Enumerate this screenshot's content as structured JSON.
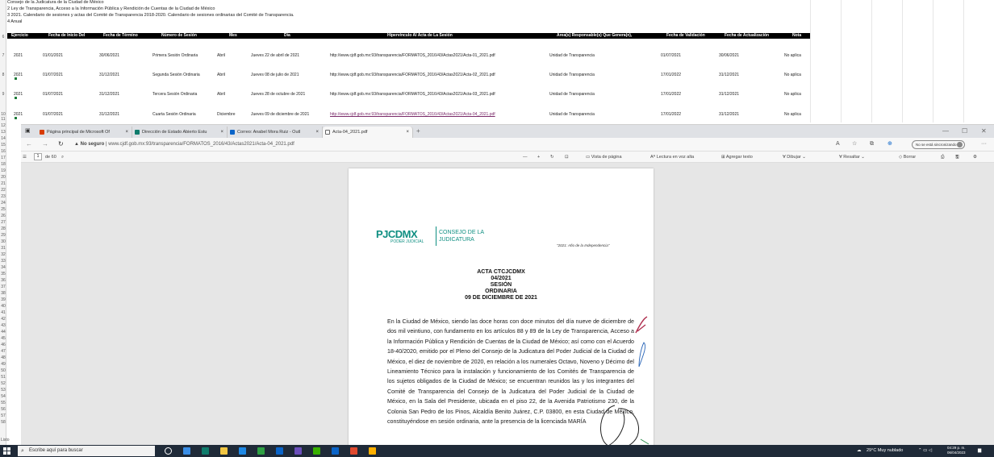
{
  "spreadsheet": {
    "top_rows": [
      "Consejo de la Judicatura de la Ciudad de México",
      "2  Ley de Transparencia, Acceso a la Información Pública y Rendición de Cuentas de la Ciudad de México",
      "3  2021. Calendario de sesiones y actas del Comité de Transparencia 2018-2020. Calendario de sesiones ordinarias del Comité de Transparencia.",
      "4  Anual"
    ],
    "headers": [
      "Ejercicio",
      "Fecha de Inicio Del",
      "Fecha de Término",
      "Número de Sesión",
      "Mes",
      "Día",
      "Hipervínculo Al Acta de La Sesión",
      "Área(s) Responsable(s) Que Genera(n),",
      "Fecha de Validación",
      "Fecha de Actualización",
      "Nota"
    ],
    "rows": [
      {
        "rownum": "7",
        "cells": [
          "2021",
          "01/01/2021",
          "30/06/2021",
          "Primera Sesión Ordinaria",
          "Abril",
          "Jueves 22 de abril de 2021",
          "http://www.cjdf.gob.mx:93/transparencia/FORMATOS_2016/43/Actas2021/Acta-01_2021.pdf",
          "Unidad de Transparencia",
          "01/07/2021",
          "30/06/2021",
          "No aplica"
        ]
      },
      {
        "rownum": "8",
        "cells": [
          "2021",
          "01/07/2021",
          "31/12/2021",
          "Segunda Sesión Ordinaria",
          "Abril",
          "Jueves 08 de julio de 2021",
          "http://www.cjdf.gob.mx:93/transparencia/FORMATOS_2016/43/Actas2021/Acta-02_2021.pdf",
          "Unidad de Transparencia",
          "17/01/2022",
          "31/12/2021",
          "No aplica"
        ]
      },
      {
        "rownum": "9",
        "cells": [
          "2021",
          "01/07/2021",
          "31/12/2021",
          "Tercera Sesión Ordinaria",
          "Abril",
          "Jueves 28 de octubre de 2021",
          "http://www.cjdf.gob.mx:93/transparencia/FORMATOS_2016/43/Actas2021/Acta-03_2021.pdf",
          "Unidad de Transparencia",
          "17/01/2022",
          "31/12/2021",
          "No aplica"
        ]
      },
      {
        "rownum": "10",
        "cells": [
          "2021",
          "01/07/2021",
          "31/12/2021",
          "Cuarta Sesión Ordinaria",
          "Diciembre",
          "Jueves 09 de diciembre de 2021",
          "http://www.cjdf.gob.mx:93/transparencia/FORMATOS_2016/43/Actas2021/Acta-04_2021.pdf",
          "Unidad de Transparencia",
          "17/01/2022",
          "31/12/2021",
          "No aplica"
        ]
      }
    ],
    "header_rownum": "6",
    "row_numbers_left": [
      "11",
      "12",
      "13",
      "14",
      "15",
      "16",
      "17",
      "18",
      "19",
      "20",
      "21",
      "22",
      "23",
      "24",
      "25",
      "26",
      "27",
      "28",
      "29",
      "30",
      "31",
      "32",
      "33",
      "34",
      "35",
      "36",
      "37",
      "38",
      "39",
      "40",
      "41",
      "42",
      "43",
      "44",
      "45",
      "46",
      "47",
      "48",
      "49",
      "50",
      "51",
      "52",
      "53",
      "54",
      "55",
      "56",
      "57",
      "58"
    ],
    "listo": "Listo"
  },
  "browser": {
    "tabs": [
      {
        "label": "Página principal de Microsoft Of",
        "color": "#d83b01"
      },
      {
        "label": "Dirección de Estado Abierto Estu",
        "color": "#0f7c6c"
      },
      {
        "label": "Correo: Anabel Mora Ruiz - Outl",
        "color": "#0a64c8"
      },
      {
        "label": "Acta-04_2021.pdf",
        "color": "#666666"
      }
    ],
    "new_tab": "+",
    "tab_close": "×",
    "window_controls": [
      "—",
      "☐",
      "✕"
    ],
    "address": {
      "warning": "▲ No seguro",
      "separator": "|",
      "url": "www.cjdf.gob.mx:93/transparencia/FORMATOS_2016/43/Actas2021/Acta-04_2021.pdf"
    },
    "sync_label": "No se está sincronizando",
    "pdf_toolbar": {
      "page_current": "1",
      "page_total": "de 60",
      "items": [
        "Vista de página",
        "Lectura en voz alta",
        "Agregar texto",
        "Dibujar",
        "Resaltar",
        "Borrar"
      ],
      "zoom_out": "—",
      "zoom_in": "+"
    }
  },
  "document": {
    "logo_mark": "PJCDMX",
    "logo_sub": "PODER JUDICIAL",
    "logo_right_1": "CONSEJO DE LA",
    "logo_right_2": "JUDICATURA",
    "year_note": "\"2021: Año de la Independencia\"",
    "heading": [
      "ACTA CTCJCDMX",
      "04/2021",
      "SESIÓN",
      "ORDINARIA",
      "09 DE DICIEMBRE DE 2021"
    ],
    "body": "En la Ciudad de México, siendo las doce horas con doce minutos del día nueve de diciembre de dos mil veintiuno, con fundamento en los artículos 88 y 89 de la Ley de Transparencia, Acceso a la Información Pública y Rendición de Cuentas de la Ciudad de México; así como con el Acuerdo 18-40/2020, emitido por el Pleno del Consejo de la Judicatura del Poder Judicial de la Ciudad de México, el diez de noviembre de 2020, en relación a los numerales Octavo, Noveno y Décimo del Lineamiento Técnico para la instalación y funcionamiento de los Comités de Transparencia de los sujetos obligados de la Ciudad de México; se encuentran reunidos las y los integrantes del Comité de Transparencia del Consejo de la Judicatura del Poder Judicial de la Ciudad de México, en la Sala del Presidente, ubicada en el piso 22, de la Avenida Patriotismo 230, de la Colonia San Pedro de los Pinos, Alcaldía Benito Juárez, C.P. 03800, en esta Ciudad de México, constituyéndose en sesión ordinaria, ante la presencia de la licenciada MARÍA"
  },
  "taskbar": {
    "search_placeholder": "Escribe aquí para buscar",
    "weather": "29°C  Muy nublado",
    "time": "04:29 p. m.",
    "date": "06/04/2023",
    "app_colors": [
      "#ffffff",
      "#3a8ee6",
      "#0f7c6c",
      "#f2c744",
      "#1e88e5",
      "#2ea043",
      "#0a64c8",
      "#6b4fbb",
      "#38b000",
      "#0a64c8",
      "#e04a2f",
      "#ffb000"
    ]
  }
}
